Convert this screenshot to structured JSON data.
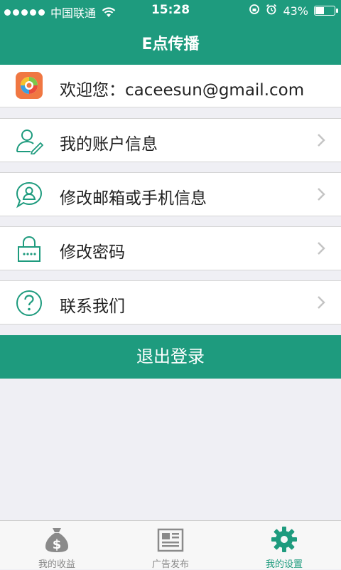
{
  "status_bar": {
    "carrier": "中国联通",
    "time": "15:28",
    "battery": "43%",
    "battery_level": 0.43
  },
  "header": {
    "title": "E点传播"
  },
  "welcome": {
    "text": "欢迎您：caceesun@gmail.com"
  },
  "menu": {
    "items": [
      {
        "label": "我的账户信息",
        "icon": "user-edit-icon"
      },
      {
        "label": "修改邮箱或手机信息",
        "icon": "chat-user-icon"
      },
      {
        "label": "修改密码",
        "icon": "lock-icon"
      },
      {
        "label": "联系我们",
        "icon": "question-icon"
      }
    ]
  },
  "logout": {
    "label": "退出登录"
  },
  "tabbar": {
    "tabs": [
      {
        "label": "我的收益",
        "icon": "money-bag-icon"
      },
      {
        "label": "广告发布",
        "icon": "newspaper-icon"
      },
      {
        "label": "我的设置",
        "icon": "gear-icon",
        "active": true
      }
    ]
  },
  "colors": {
    "accent": "#1e9b7e",
    "background": "#efeff4"
  }
}
